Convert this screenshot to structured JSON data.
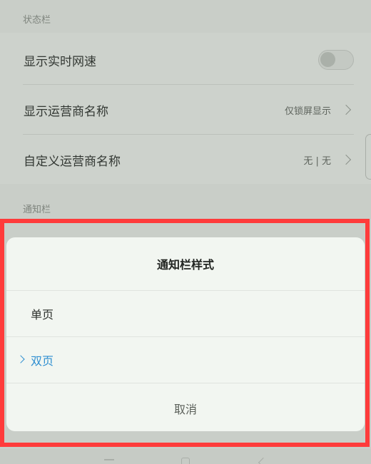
{
  "status_section": {
    "header": "状态栏",
    "rows": [
      {
        "label": "显示实时网速",
        "value": ""
      },
      {
        "label": "显示运营商名称",
        "value": "仅锁屏显示"
      },
      {
        "label": "自定义运营商名称",
        "value": "无 | 无"
      }
    ]
  },
  "notification_section": {
    "header": "通知栏"
  },
  "dialog": {
    "title": "通知栏样式",
    "options": [
      {
        "label": "单页",
        "selected": false
      },
      {
        "label": "双页",
        "selected": true
      }
    ],
    "cancel_label": "取消"
  },
  "colors": {
    "highlight": "#ff3b3b",
    "accent": "#2f8fd1"
  },
  "icons": [
    "chevron-right-icon",
    "toggle-switch",
    "selected-chevron-icon",
    "back-icon",
    "home-icon",
    "menu-icon"
  ]
}
